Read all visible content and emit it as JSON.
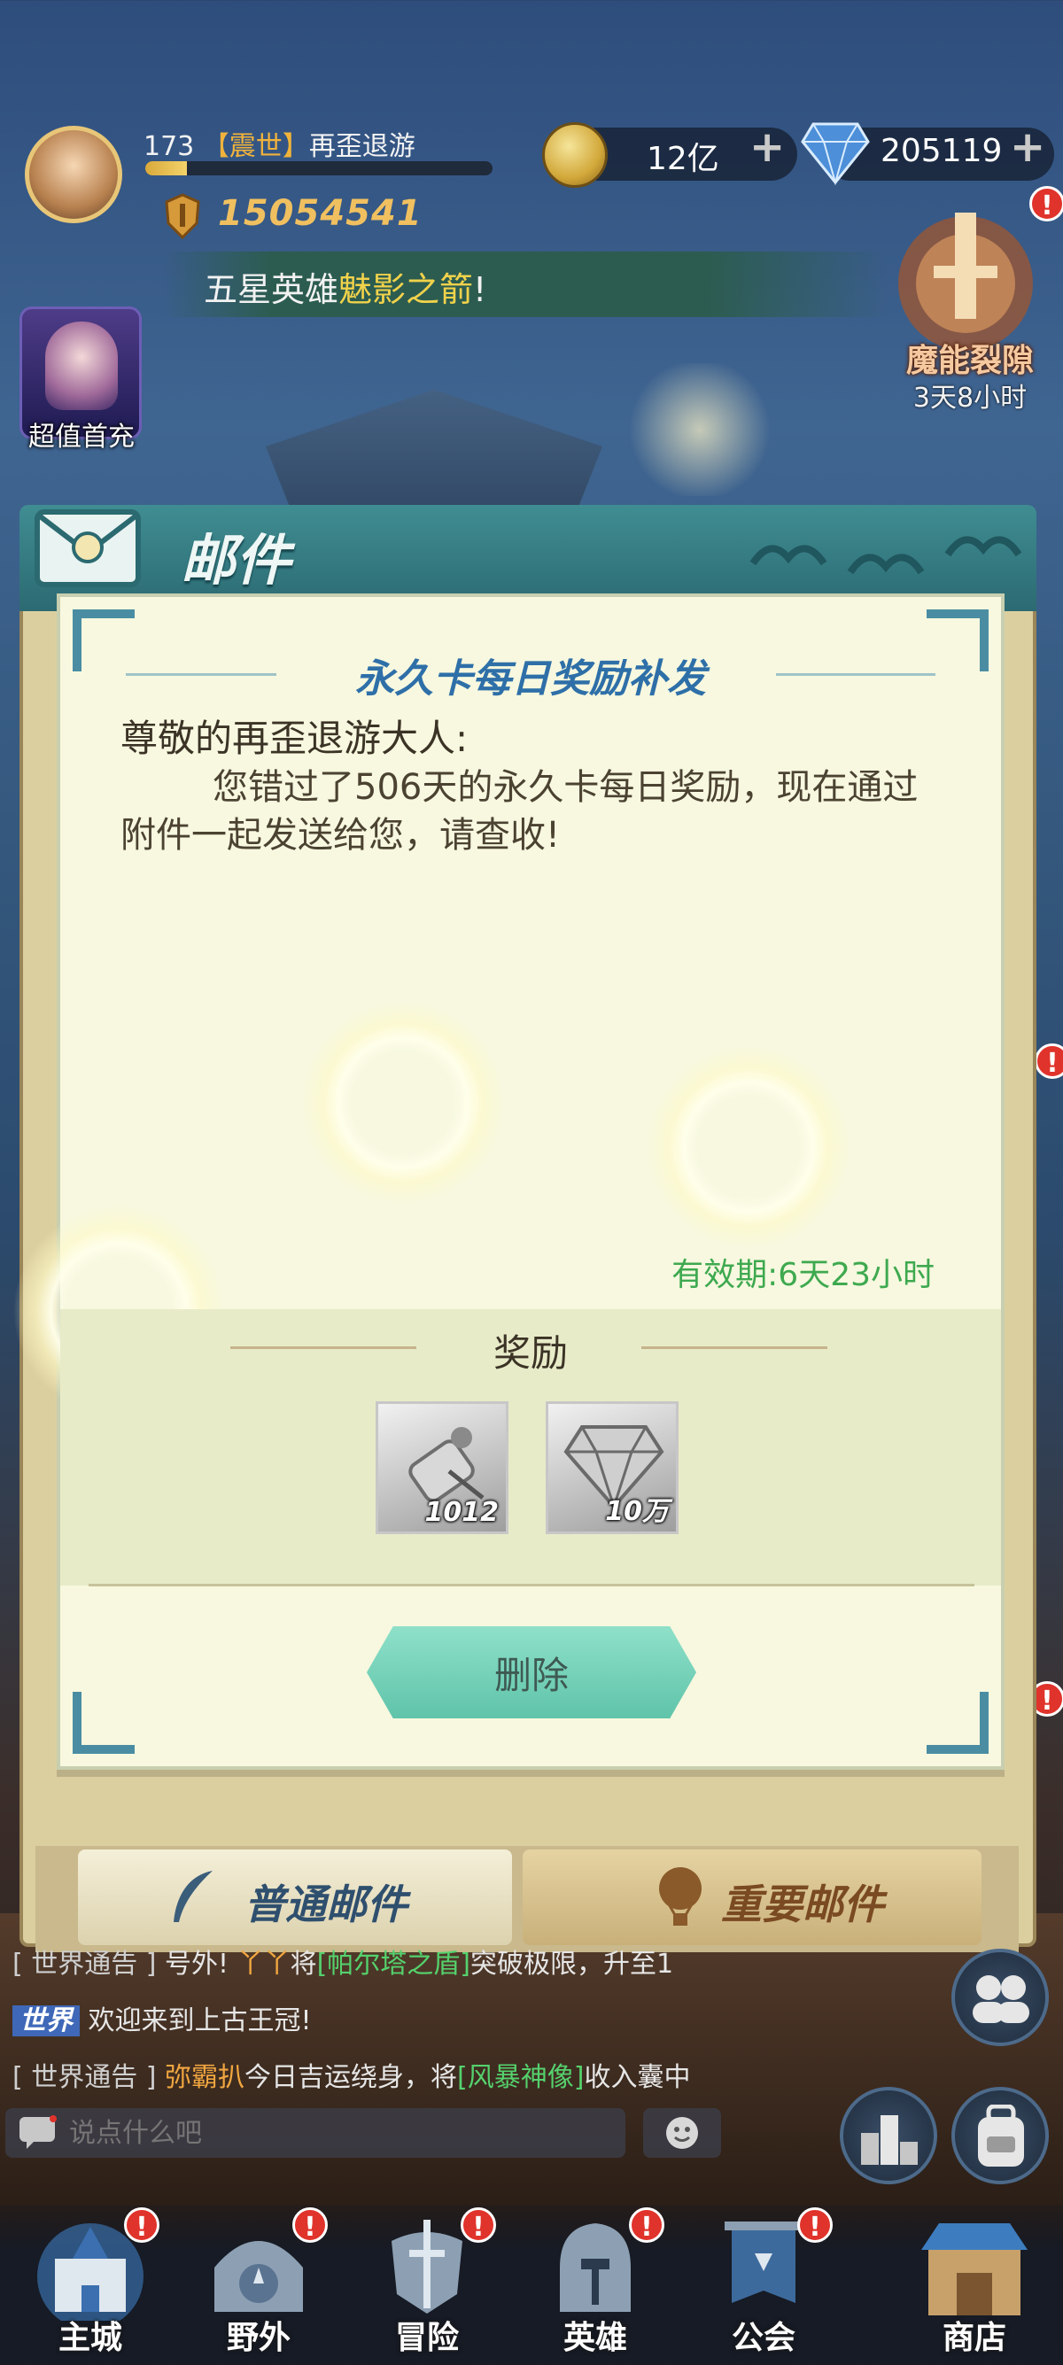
{
  "player": {
    "level": "173",
    "guild_tag": "【震世】",
    "name": "再歪退游",
    "xp_fraction": 0.12,
    "power": "15054541"
  },
  "resources": {
    "gold": "12亿",
    "diamonds": "205119"
  },
  "notice": {
    "prefix": "五星英雄",
    "highlight": "魅影之箭",
    "suffix": "!"
  },
  "first_recharge": {
    "label": "超值首充"
  },
  "rift": {
    "label": "魔能裂隙",
    "countdown": "3天8小时",
    "badge": "!"
  },
  "mail": {
    "window_title": "邮件",
    "letter_title": "永久卡每日奖励补发",
    "greeting": "尊敬的再歪退游大人:",
    "body": "您错过了506天的永久卡每日奖励，现在通过附件一起发送给您，请查收!",
    "expiry": "有效期:6天23小时",
    "reward_title": "奖励",
    "items": [
      {
        "icon": "scroll-icon",
        "count": "1012"
      },
      {
        "icon": "diamond-icon",
        "count": "10万"
      }
    ],
    "delete_label": "删除",
    "tabs": {
      "normal": "普通邮件",
      "important": "重要邮件"
    }
  },
  "chat": {
    "line1": {
      "tag": "[ 世界通告 ]",
      "pre": "号外! ",
      "player": "丫丫",
      "mid": "将",
      "item": "[帕尔塔之盾]",
      "post": "突破极限，升至1"
    },
    "line2": {
      "channel": "世界",
      "text": "欢迎来到上古王冠!"
    },
    "line3": {
      "tag": "[ 世界通告 ]",
      "player": "弥霸扒",
      "mid": "今日吉运绕身，将",
      "item": "[风暴神像]",
      "post": "收入囊中"
    },
    "input_placeholder": "说点什么吧"
  },
  "nav": {
    "items": [
      {
        "label": "主城",
        "badge": "!"
      },
      {
        "label": "野外",
        "badge": "!"
      },
      {
        "label": "冒险",
        "badge": "!"
      },
      {
        "label": "英雄",
        "badge": "!"
      },
      {
        "label": "公会",
        "badge": "!"
      },
      {
        "label": "商店"
      }
    ]
  },
  "side_badges": [
    "!",
    "!"
  ],
  "colors": {
    "accent_teal": "#3f8d92",
    "title_blue": "#2e6fa8",
    "expiry_green": "#3ea94f",
    "gold_text": "#f0c060",
    "badge_red": "#e0332b"
  }
}
